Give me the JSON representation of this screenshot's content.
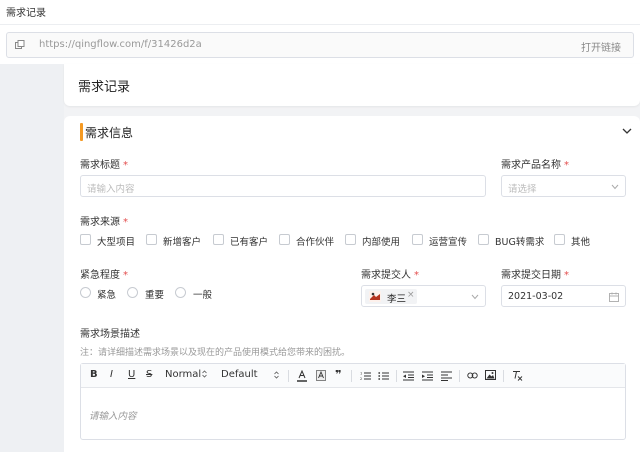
{
  "window_title": "需求记录",
  "urlbar": {
    "url": "https://qingflow.com/f/31426d2a",
    "open_label": "打开链接"
  },
  "header": {
    "title": "需求记录"
  },
  "section": {
    "title": "需求信息",
    "accent": "#f59a23"
  },
  "fields": {
    "title": {
      "label": "需求标题",
      "required": "*",
      "placeholder": "请输入内容"
    },
    "product": {
      "label": "需求产品名称",
      "required": "*",
      "placeholder": "请选择"
    },
    "source": {
      "label": "需求来源",
      "required": "*",
      "options": [
        "大型项目",
        "新增客户",
        "已有客户",
        "合作伙伴",
        "内部使用",
        "运营宣传",
        "BUG转需求",
        "其他"
      ]
    },
    "urgency": {
      "label": "紧急程度",
      "required": "*",
      "options": [
        "紧急",
        "重要",
        "一般"
      ]
    },
    "submitter": {
      "label": "需求提交人",
      "required": "*",
      "value": "李三",
      "remove": "×"
    },
    "date": {
      "label": "需求提交日期",
      "required": "*",
      "value": "2021-03-02"
    },
    "scenario": {
      "label": "需求场景描述",
      "note": "注：请详细描述需求场景以及现在的产品使用模式给您带来的困扰。",
      "placeholder": "请输入内容"
    }
  },
  "editor_toolbar": {
    "bold": "B",
    "italic": "I",
    "underline": "U",
    "strike": "S",
    "heading": "Normal",
    "font": "Default",
    "quote": "❞"
  }
}
